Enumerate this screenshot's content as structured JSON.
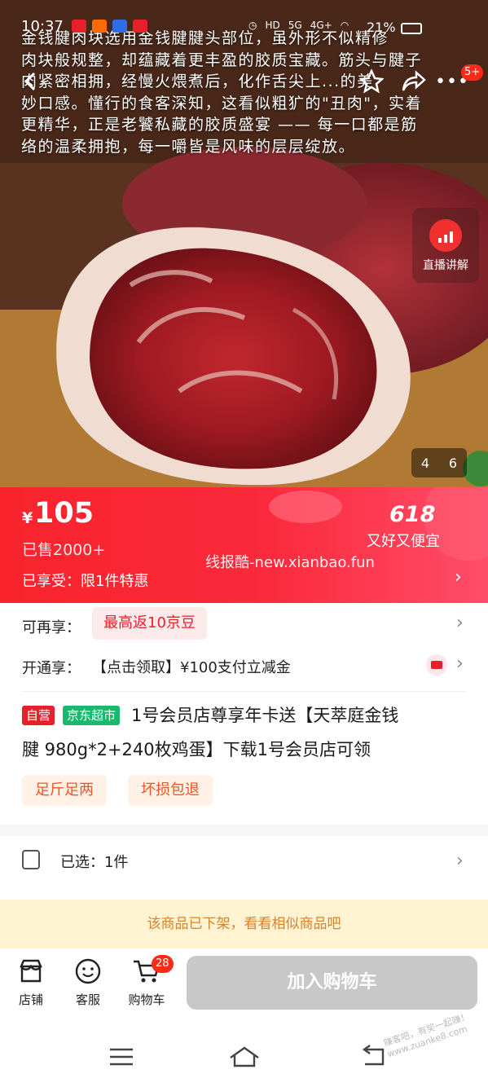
{
  "status_bar": {
    "time": "10:37",
    "battery": "21%",
    "signal_labels": [
      "HD",
      "5G",
      "4G+"
    ]
  },
  "hero": {
    "caption": "金钱腱肉块选用金钱腱腱头部位，虽外形不似精修\n肉块般规整，却蕴藏着更丰盈的胶质宝藏。筋头与腱子\n肉紧密相拥，经慢火煨煮后，化作舌尖上...的美\n妙口感。懂行的食客深知，这看似粗犷的\"丑肉\"，实着\n更精华，正是老饕私藏的胶质盛宴 —— 每一口都是筋\n络的温柔拥抱，每一嚼皆是风味的层层绽放。",
    "notification_badge": "5+",
    "live_label": "直播讲解",
    "page_current": "4",
    "page_total": "6"
  },
  "price": {
    "currency": "¥",
    "value": "105",
    "sold": "已售2000+",
    "promo_number": "618",
    "promo_slogan": "又好又便宜",
    "watermark": "线报酷-new.xianbao.fun",
    "enjoyed": "已享受：限1件特惠"
  },
  "benefits": {
    "more_label": "可再享：",
    "rebate": "最高返10京豆",
    "open_label": "开通享：",
    "pay_offer": "【点击领取】¥100支付立减金"
  },
  "product": {
    "tag_self": "自营",
    "tag_jd": "京东超市",
    "title_line1": "1号会员店尊享年卡送【天萃庭金钱",
    "title_line2": "腱 980g*2+240枚鸡蛋】下载1号会员店可领",
    "features": [
      "足斤足两",
      "坏损包退"
    ]
  },
  "selection": {
    "text": "已选：1件"
  },
  "notice": {
    "offshelf": "该商品已下架，看看相似商品吧"
  },
  "bottom_bar": {
    "store": "店铺",
    "service": "客服",
    "cart": "购物车",
    "cart_count": "28",
    "add_to_cart": "加入购物车"
  },
  "footer_watermark": "赚客吧，有奖一起赚！www.zuanke8.com",
  "colors": {
    "brand_red": "#f8232c",
    "jd_green": "#19b86d",
    "disabled_gray": "#c8c8c8",
    "notice_bg": "#fff3d1"
  }
}
